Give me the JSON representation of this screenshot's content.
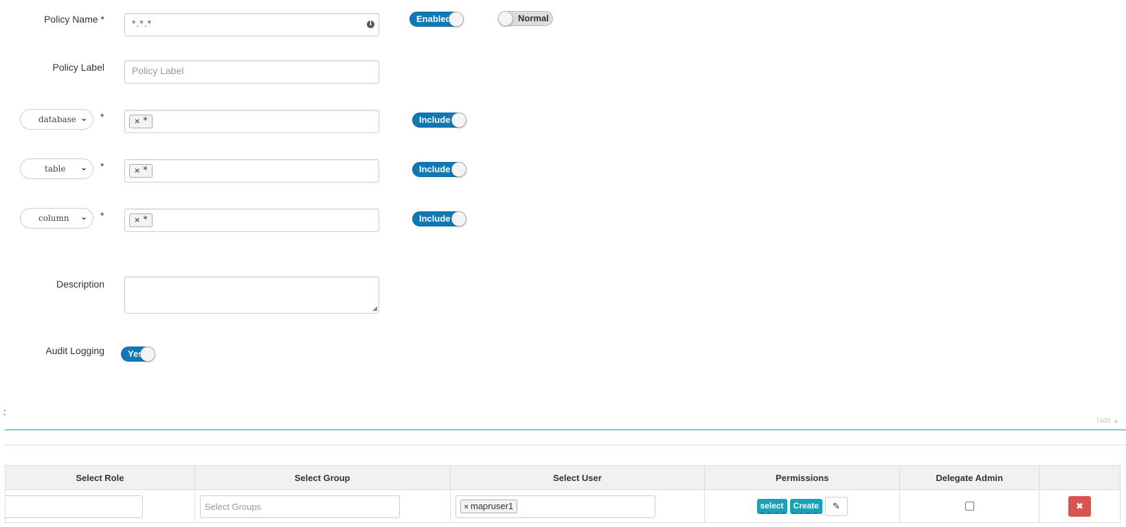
{
  "policy": {
    "name_label": "Policy Name *",
    "name_value": "*.*.*",
    "info_icon": "info-icon",
    "enabled_label": "Enabled",
    "normal_label": "Normal",
    "label_label": "Policy Label",
    "label_placeholder": "Policy Label"
  },
  "resources": [
    {
      "type": "database",
      "value": "*",
      "toggle": "Include"
    },
    {
      "type": "table",
      "value": "*",
      "toggle": "Include"
    },
    {
      "type": "column",
      "value": "*",
      "toggle": "Include"
    }
  ],
  "required_mark": "*",
  "remove_mark": "×",
  "description_label": "Description",
  "audit": {
    "label": "Audit Logging",
    "toggle": "Yes"
  },
  "section": {
    "colon": ":",
    "hide": "hide"
  },
  "table": {
    "headers": [
      "Select Role",
      "Select Group",
      "Select User",
      "Permissions",
      "Delegate Admin",
      ""
    ],
    "group_placeholder": "Select Groups",
    "user_tag": "mapruser1",
    "permissions": [
      "select",
      "Create"
    ],
    "edit_icon": "pencil-icon",
    "delete_icon": "close-icon"
  },
  "colors": {
    "toggle_on": "#0f78b5",
    "perm_tag": "#17a2b8",
    "delete": "#d9534f",
    "teal_rule": "#1c9bb3"
  }
}
